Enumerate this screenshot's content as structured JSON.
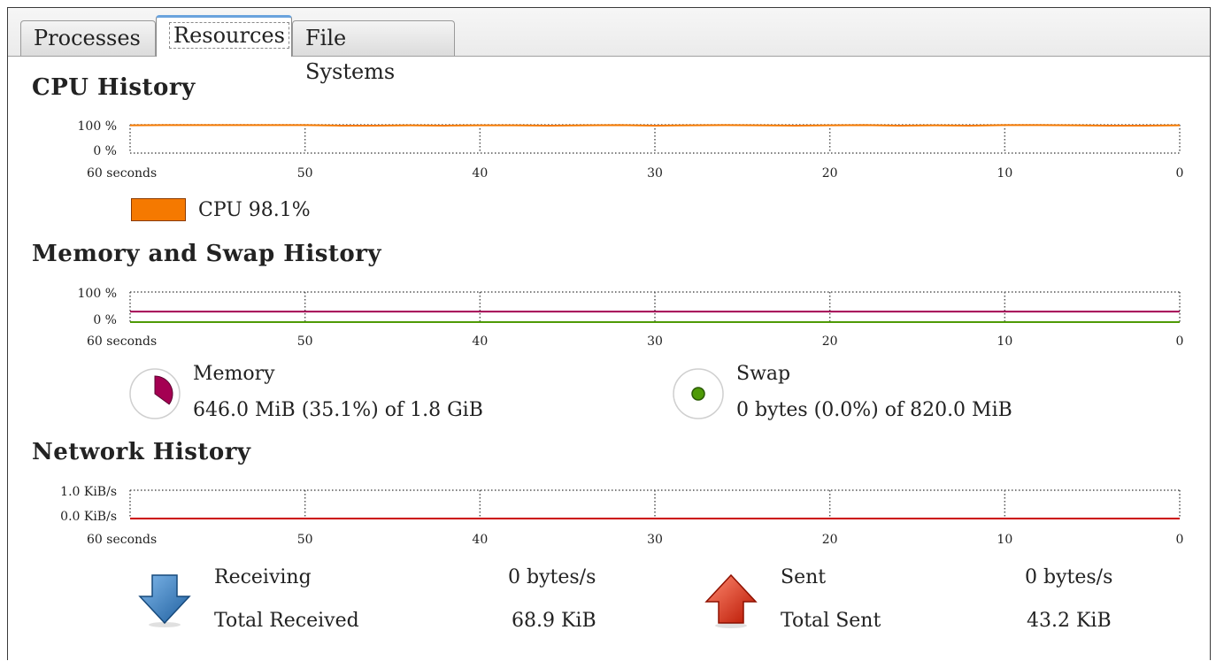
{
  "tabs": [
    {
      "label": "Processes",
      "active": false
    },
    {
      "label": "Resources",
      "active": true
    },
    {
      "label": "File Systems",
      "active": false
    }
  ],
  "cpu": {
    "title": "CPU History",
    "y_top": "100 %",
    "y_bottom": "0 %",
    "x_labels": [
      "60 seconds",
      "50",
      "40",
      "30",
      "20",
      "10",
      "0"
    ],
    "legend": {
      "label": "CPU 98.1%",
      "color": "#f57900"
    },
    "chart_data": {
      "type": "line",
      "xlim": [
        60,
        0
      ],
      "ylim": [
        0,
        100
      ],
      "series": [
        {
          "name": "CPU",
          "color": "#f57900",
          "x": [
            60,
            58,
            56,
            54,
            52,
            50,
            48,
            46,
            44,
            42,
            40,
            38,
            36,
            34,
            32,
            30,
            28,
            26,
            24,
            22,
            20,
            18,
            16,
            14,
            12,
            10,
            8,
            6,
            4,
            2,
            0
          ],
          "y": [
            98,
            99,
            99,
            99,
            99,
            99,
            97,
            97,
            98,
            97,
            98,
            98,
            97,
            98,
            99,
            97,
            98,
            99,
            98,
            97,
            98,
            99,
            97,
            98,
            97,
            99,
            99,
            98,
            97,
            97,
            98
          ]
        }
      ]
    }
  },
  "memory": {
    "title": "Memory and Swap History",
    "y_top": "100 %",
    "y_bottom": "0 %",
    "x_labels": [
      "60 seconds",
      "50",
      "40",
      "30",
      "20",
      "10",
      "0"
    ],
    "chart_data": {
      "type": "line",
      "xlim": [
        60,
        0
      ],
      "ylim": [
        0,
        100
      ],
      "series": [
        {
          "name": "Memory",
          "color": "#a40052",
          "x": [
            60,
            0
          ],
          "y": [
            35.1,
            35.1
          ]
        },
        {
          "name": "Swap",
          "color": "#4e9a06",
          "x": [
            60,
            0
          ],
          "y": [
            0,
            0
          ]
        }
      ]
    },
    "mem_label": "Memory",
    "mem_value": "646.0 MiB (35.1%) of 1.8 GiB",
    "mem_fraction": 0.351,
    "mem_color": "#a40052",
    "swap_label": "Swap",
    "swap_value": "0 bytes (0.0%) of 820.0 MiB",
    "swap_fraction": 0.0,
    "swap_color": "#4e9a06"
  },
  "network": {
    "title": "Network History",
    "y_top": "1.0 KiB/s",
    "y_bottom": "0.0 KiB/s",
    "x_labels": [
      "60 seconds",
      "50",
      "40",
      "30",
      "20",
      "10",
      "0"
    ],
    "chart_data": {
      "type": "line",
      "xlim": [
        60,
        0
      ],
      "ylim": [
        0,
        1.0
      ],
      "series": [
        {
          "name": "Receiving",
          "color": "#3465a4",
          "x": [
            60,
            0
          ],
          "y": [
            0,
            0
          ]
        },
        {
          "name": "Sent",
          "color": "#cc0000",
          "x": [
            60,
            0
          ],
          "y": [
            0,
            0
          ]
        }
      ]
    },
    "receiving_label": "Receiving",
    "receiving_value": "0 bytes/s",
    "total_received_label": "Total Received",
    "total_received_value": "68.9 KiB",
    "sent_label": "Sent",
    "sent_value": "0 bytes/s",
    "total_sent_label": "Total Sent",
    "total_sent_value": "43.2 KiB",
    "receive_icon": "down-arrow-icon",
    "send_icon": "up-arrow-icon",
    "receive_color": "#3a7fc0",
    "send_color": "#e02a1a"
  }
}
